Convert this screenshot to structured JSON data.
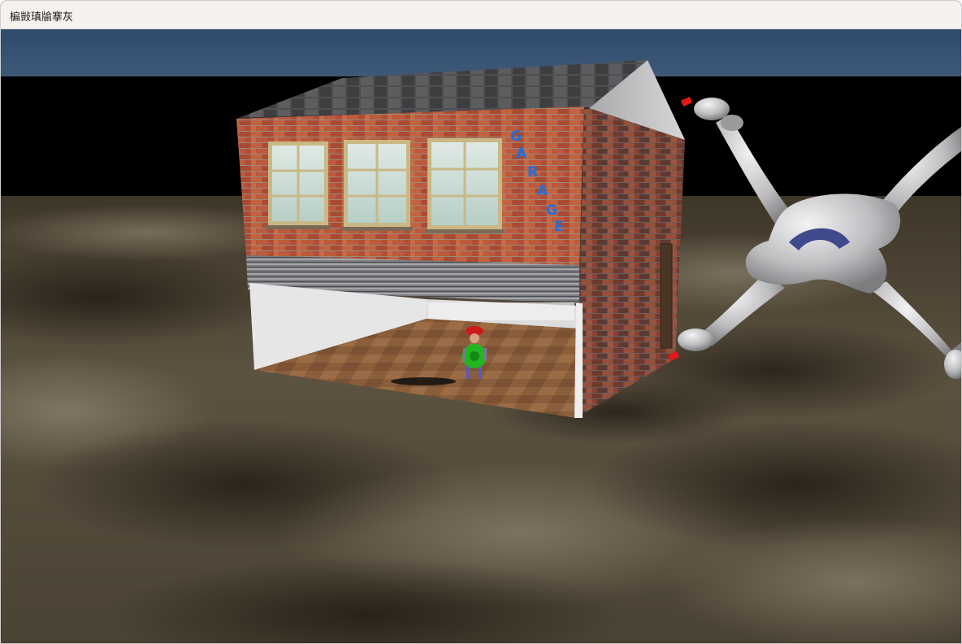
{
  "window": {
    "title": "楄敱瑱牏搴灰"
  },
  "scene": {
    "sign_letters": [
      "G",
      "A",
      "R",
      "A",
      "G",
      "E"
    ],
    "colors": {
      "sky_band": "#3a5474",
      "night_sky": "#000000",
      "ground": "#5a5040",
      "brick": "#b8543a",
      "roof": "#4c4c4e",
      "sign_text": "#1f6fe0",
      "drone_body": "#bfbfc2",
      "drone_logo": "#3f4a8c",
      "rotor_tip": "#e01818",
      "character_hat": "#cc1a1a",
      "character_shell": "#22b622"
    },
    "objects": [
      "garage",
      "drone",
      "character",
      "terrain"
    ]
  }
}
